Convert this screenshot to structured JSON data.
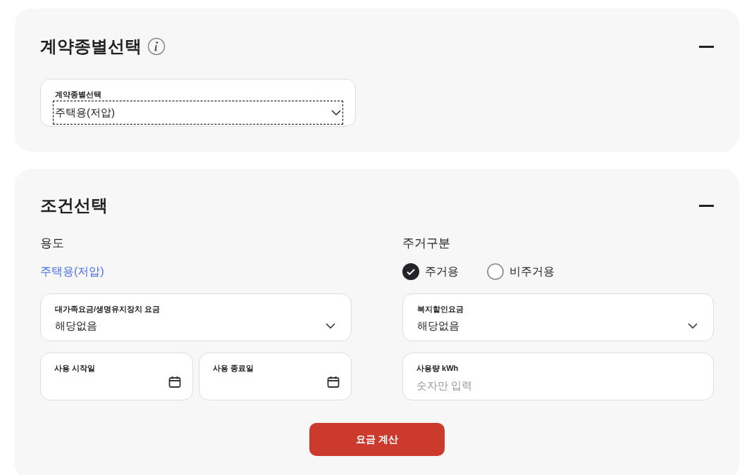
{
  "contract_section": {
    "title": "계약종별선택",
    "expanded": true,
    "select": {
      "label": "계약종별선택",
      "value": "주택용(저압)",
      "focused": true
    }
  },
  "condition_section": {
    "title": "조건선택",
    "expanded": true,
    "usage": {
      "label": "용도",
      "value": "주택용(저압)"
    },
    "family_fee": {
      "label": "대가족요금/생명유지장치 요금",
      "value": "해당없음"
    },
    "start_date": {
      "label": "사용 시작일"
    },
    "end_date": {
      "label": "사용 종료일"
    },
    "residence": {
      "label": "주거구분",
      "options": [
        {
          "label": "주거용",
          "selected": true
        },
        {
          "label": "비주거용",
          "selected": false
        }
      ]
    },
    "welfare_fee": {
      "label": "복지할인요금",
      "value": "해당없음"
    },
    "consumption": {
      "label": "사용량 kWh",
      "placeholder": "숫자만 입력"
    },
    "submit": "요금 계산"
  }
}
